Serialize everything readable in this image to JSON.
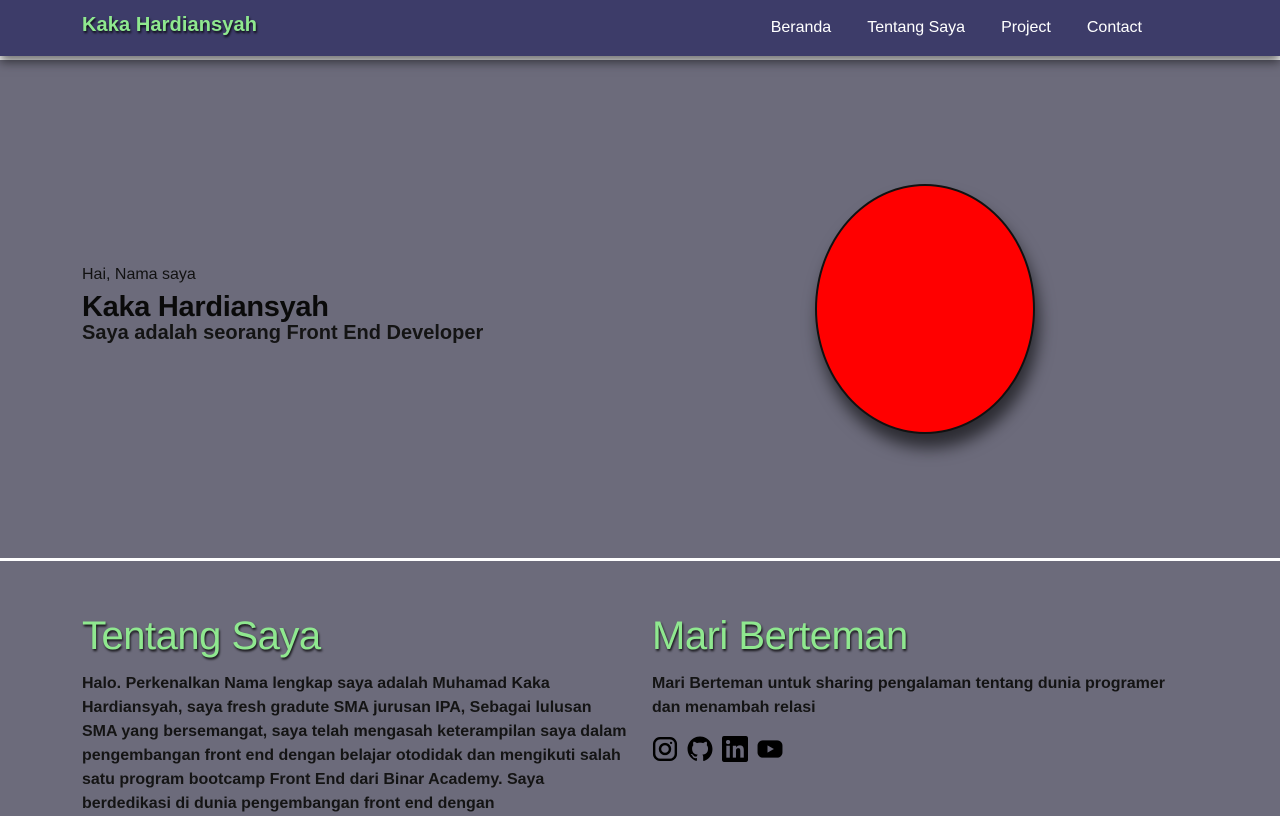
{
  "navbar": {
    "brand": "Kaka Hardiansyah",
    "links": [
      "Beranda",
      "Tentang Saya",
      "Project",
      "Contact"
    ]
  },
  "hero": {
    "greeting": "Hai, Nama saya",
    "name": "Kaka Hardiansyah",
    "role": "Saya adalah seorang Front End Developer",
    "avatar_color": "#ff0000"
  },
  "about": {
    "title": "Tentang Saya",
    "text": "Halo. Perkenalkan Nama lengkap saya adalah Muhamad Kaka Hardiansyah, saya fresh gradute SMA jurusan IPA, Sebagai lulusan SMA yang bersemangat, saya telah mengasah keterampilan saya dalam pengembangan front end dengan belajar otodidak dan mengikuti salah satu program bootcamp Front End dari Binar Academy. Saya berdedikasi di dunia pengembangan front end dengan"
  },
  "friends": {
    "title": "Mari Berteman",
    "text": "Mari Berteman untuk sharing pengalaman tentang dunia programer dan menambah relasi",
    "socials": [
      "instagram-icon",
      "github-icon",
      "linkedin-icon",
      "youtube-icon"
    ]
  },
  "colors": {
    "navbar_bg": "#3d3c69",
    "page_bg": "#6c6b7b",
    "accent_green": "#8fe88f"
  }
}
